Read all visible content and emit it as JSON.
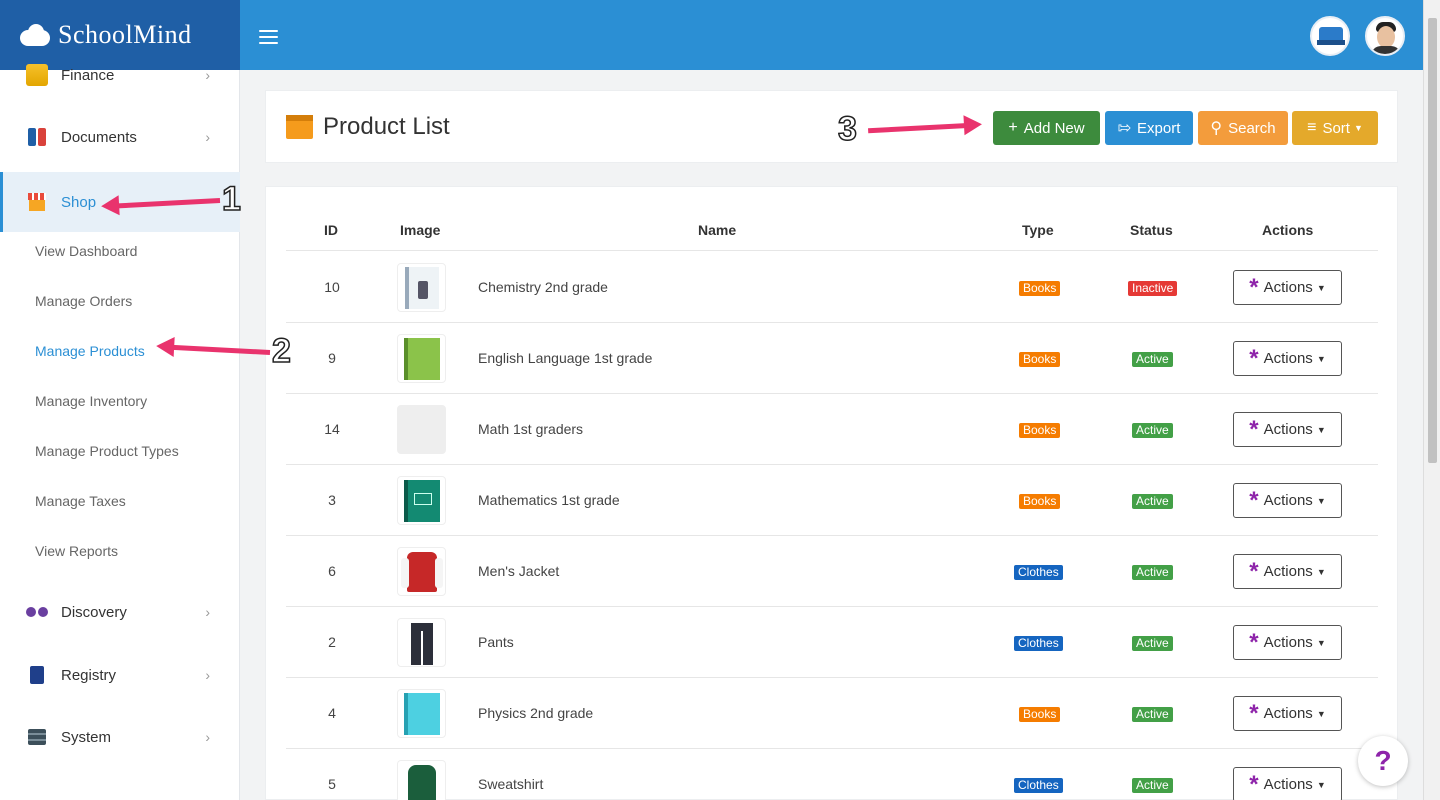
{
  "brand": {
    "name": "SchoolMind"
  },
  "sidebar": {
    "items": [
      {
        "label": "Finance",
        "icon": "coins-icon"
      },
      {
        "label": "Documents",
        "icon": "binders-icon"
      },
      {
        "label": "Shop",
        "icon": "store-icon",
        "active": true
      },
      {
        "label": "Discovery",
        "icon": "binoculars-icon"
      },
      {
        "label": "Registry",
        "icon": "registry-book-icon"
      },
      {
        "label": "System",
        "icon": "server-icon"
      }
    ],
    "shop_sub": [
      "View Dashboard",
      "Manage Orders",
      "Manage Products",
      "Manage Inventory",
      "Manage Product Types",
      "Manage Taxes",
      "View Reports"
    ]
  },
  "header": {
    "title": "Product List",
    "buttons": {
      "add": "Add New",
      "export": "Export",
      "search": "Search",
      "sort": "Sort"
    }
  },
  "table": {
    "columns": [
      "ID",
      "Image",
      "Name",
      "Type",
      "Status",
      "Actions"
    ],
    "rows": [
      {
        "id": "10",
        "name": "Chemistry 2nd grade",
        "type": "Books",
        "status": "Inactive",
        "action": "Actions"
      },
      {
        "id": "9",
        "name": "English Language 1st grade",
        "type": "Books",
        "status": "Active",
        "action": "Actions"
      },
      {
        "id": "14",
        "name": "Math 1st graders",
        "type": "Books",
        "status": "Active",
        "action": "Actions"
      },
      {
        "id": "3",
        "name": "Mathematics 1st grade",
        "type": "Books",
        "status": "Active",
        "action": "Actions"
      },
      {
        "id": "6",
        "name": "Men's Jacket",
        "type": "Clothes",
        "status": "Active",
        "action": "Actions"
      },
      {
        "id": "2",
        "name": "Pants",
        "type": "Clothes",
        "status": "Active",
        "action": "Actions"
      },
      {
        "id": "4",
        "name": "Physics 2nd grade",
        "type": "Books",
        "status": "Active",
        "action": "Actions"
      },
      {
        "id": "5",
        "name": "Sweatshirt",
        "type": "Clothes",
        "status": "Active",
        "action": "Actions"
      }
    ]
  },
  "annotations": [
    "1",
    "2",
    "3"
  ],
  "help": {
    "label": "?"
  },
  "colors": {
    "primary": "#2b8fd4",
    "brand_dark": "#1f5fa6",
    "add": "#3d8b3d",
    "accent": "#8e24aa",
    "arrow": "#e9336d"
  }
}
